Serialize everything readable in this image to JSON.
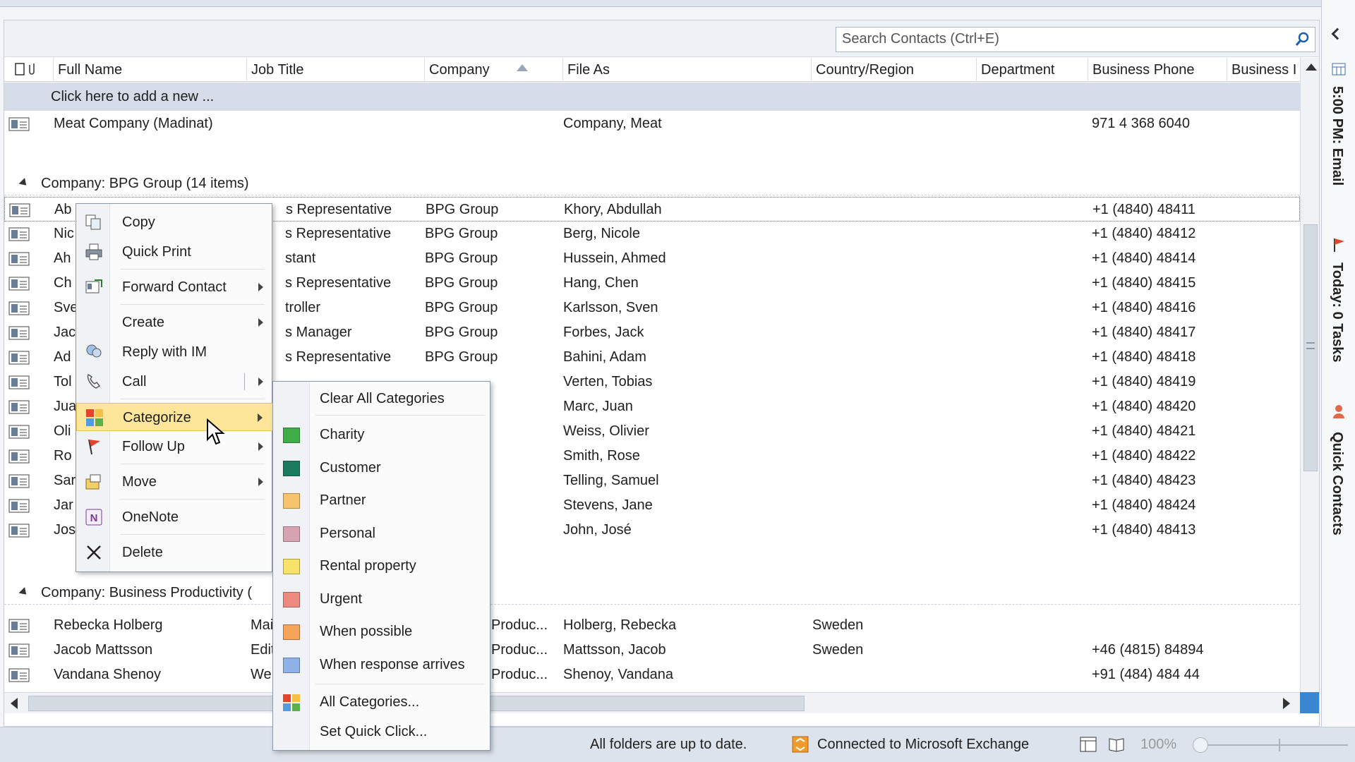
{
  "search": {
    "placeholder": "Search Contacts (Ctrl+E)"
  },
  "columns": [
    "Full Name",
    "Job Title",
    "Company",
    "File As",
    "Country/Region",
    "Department",
    "Business Phone",
    "Business I"
  ],
  "add_new": "Click here to add a new ...",
  "top_row": {
    "name": "Meat Company (Madinat)",
    "file_as": "Company, Meat",
    "phone": "971 4 368 6040"
  },
  "group1": {
    "label": "Company: BPG Group (14 items)",
    "rows": [
      {
        "name": "Ab",
        "title": "s Representative",
        "company": "BPG Group",
        "file_as": "Khory, Abdullah",
        "phone": "+1 (4840) 48411"
      },
      {
        "name": "Nic",
        "title": "s Representative",
        "company": "BPG Group",
        "file_as": "Berg, Nicole",
        "phone": "+1 (4840) 48412"
      },
      {
        "name": "Ah",
        "title": "stant",
        "company": "BPG Group",
        "file_as": "Hussein, Ahmed",
        "phone": "+1 (4840) 48414"
      },
      {
        "name": "Ch",
        "title": "s Representative",
        "company": "BPG Group",
        "file_as": "Hang, Chen",
        "phone": "+1 (4840) 48415"
      },
      {
        "name": "Sve",
        "title": "troller",
        "company": "BPG Group",
        "file_as": "Karlsson, Sven",
        "phone": "+1 (4840) 48416"
      },
      {
        "name": "Jac",
        "title": "s Manager",
        "company": "BPG Group",
        "file_as": "Forbes, Jack",
        "phone": "+1 (4840) 48417"
      },
      {
        "name": "Ad",
        "title": "s Representative",
        "company": "BPG Group",
        "file_as": "Bahini, Adam",
        "phone": "+1 (4840) 48418"
      },
      {
        "name": "Tol",
        "title": "",
        "company": "",
        "file_as": "Verten, Tobias",
        "phone": "+1 (4840) 48419"
      },
      {
        "name": "Jua",
        "title": "",
        "company": "p",
        "file_as": "Marc, Juan",
        "phone": "+1 (4840) 48420"
      },
      {
        "name": "Oli",
        "title": "",
        "company": "p",
        "file_as": "Weiss, Olivier",
        "phone": "+1 (4840) 48421"
      },
      {
        "name": "Ro",
        "title": "",
        "company": "p",
        "file_as": "Smith, Rose",
        "phone": "+1 (4840) 48422"
      },
      {
        "name": "Sar",
        "title": "",
        "company": "p",
        "file_as": "Telling, Samuel",
        "phone": "+1 (4840) 48423"
      },
      {
        "name": "Jar",
        "title": "",
        "company": "p",
        "file_as": "Stevens, Jane",
        "phone": "+1 (4840) 48424"
      },
      {
        "name": "Jos",
        "title": "",
        "company": "p",
        "file_as": "John, José",
        "phone": "+1 (4840) 48413"
      }
    ]
  },
  "group2": {
    "label": "Company: Business Productivity (",
    "rows": [
      {
        "name": "Rebecka Holberg",
        "title": "Mai",
        "company": "Produc...",
        "file_as": "Holberg, Rebecka",
        "country": "Sweden",
        "phone": ""
      },
      {
        "name": "Jacob Mattsson",
        "title": "Edit",
        "company": "Produc...",
        "file_as": "Mattsson, Jacob",
        "country": "Sweden",
        "phone": "+46 (4815) 84894"
      },
      {
        "name": "Vandana Shenoy",
        "title": "We",
        "company": "Produc...",
        "file_as": "Shenoy, Vandana",
        "country": "",
        "phone": "+91 (484) 484 44"
      }
    ]
  },
  "context_menu": {
    "copy": "Copy",
    "quick_print": "Quick Print",
    "forward_contact": "Forward Contact",
    "create": "Create",
    "reply_im": "Reply with IM",
    "call": "Call",
    "categorize": "Categorize",
    "follow_up": "Follow Up",
    "move": "Move",
    "onenote": "OneNote",
    "delete": "Delete"
  },
  "categorize_menu": {
    "clear": "Clear All Categories",
    "categories": [
      {
        "label": "Charity",
        "color": "#3fae49"
      },
      {
        "label": "Customer",
        "color": "#1c7a5f"
      },
      {
        "label": "Partner",
        "color": "#f6c46b"
      },
      {
        "label": "Personal",
        "color": "#d8a3b0"
      },
      {
        "label": "Rental property",
        "color": "#f7e36a"
      },
      {
        "label": "Urgent",
        "color": "#ec8a80"
      },
      {
        "label": "When possible",
        "color": "#f4a55a"
      },
      {
        "label": "When response arrives",
        "color": "#8fb3e8"
      }
    ],
    "all": "All Categories...",
    "quick_click": "Set Quick Click..."
  },
  "right_pane": {
    "calendar": "5:00 PM: Email",
    "tasks": "Today: 0 Tasks",
    "quick_contacts": "Quick Contacts"
  },
  "status": {
    "up_to_date": "All folders are up to date.",
    "connected": "Connected to Microsoft Exchange",
    "zoom": "100%"
  }
}
